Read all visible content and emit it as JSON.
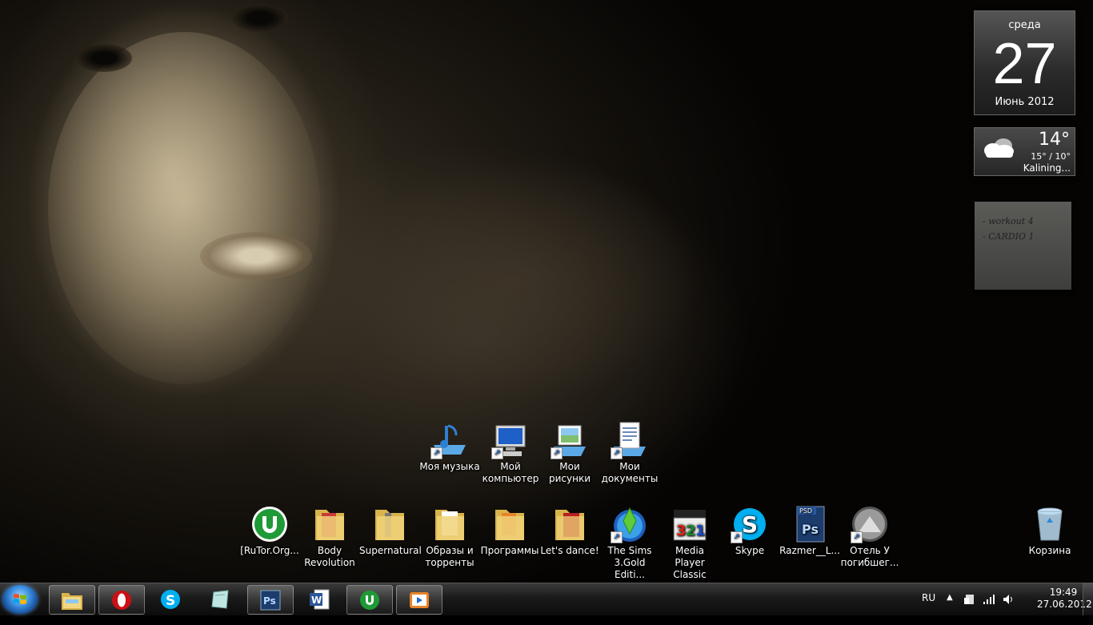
{
  "gadgets": {
    "calendar": {
      "weekday": "среда",
      "day": "27",
      "month_year": "Июнь 2012"
    },
    "weather": {
      "temperature": "14°",
      "range": "15° / 10°",
      "city": "Kalining..."
    },
    "note": {
      "lines": [
        "- workout 4",
        "- CARDIO 1"
      ]
    }
  },
  "desktop_icons_top": [
    {
      "label": "Моя музыка",
      "icon": "music-folder-icon"
    },
    {
      "label": "Мой компьютер",
      "icon": "computer-icon"
    },
    {
      "label": "Мои рисунки",
      "icon": "pictures-icon"
    },
    {
      "label": "Мои документы",
      "icon": "documents-icon"
    }
  ],
  "desktop_icons_bottom": [
    {
      "label": "[RuTor.Org...",
      "icon": "utorrent-icon"
    },
    {
      "label": "Body Revolution",
      "icon": "folder-icon"
    },
    {
      "label": "Supernatural",
      "icon": "folder-icon"
    },
    {
      "label": "Образы и торренты",
      "icon": "folder-icon"
    },
    {
      "label": "Программы",
      "icon": "folder-icon"
    },
    {
      "label": "Let's dance!",
      "icon": "folder-icon"
    },
    {
      "label": "The Sims 3.Gold Editi...",
      "icon": "sims-icon"
    },
    {
      "label": "Media Player Classic",
      "icon": "mpc-icon"
    },
    {
      "label": "Skype",
      "icon": "skype-icon"
    },
    {
      "label": "Razmer__L...",
      "icon": "psd-file-icon"
    },
    {
      "label": "Отель У погибшег...",
      "icon": "app-icon"
    }
  ],
  "recycle_bin": {
    "label": "Корзина"
  },
  "taskbar": {
    "items": [
      {
        "name": "explorer",
        "icon": "explorer-icon"
      },
      {
        "name": "opera",
        "icon": "opera-icon"
      },
      {
        "name": "skype",
        "icon": "skype-icon"
      },
      {
        "name": "sticky-notes",
        "icon": "notes-icon"
      },
      {
        "name": "photoshop",
        "icon": "photoshop-icon"
      },
      {
        "name": "word",
        "icon": "word-icon"
      },
      {
        "name": "utorrent",
        "icon": "utorrent-icon"
      },
      {
        "name": "media-player",
        "icon": "media-player-icon"
      }
    ],
    "language": "RU",
    "clock": {
      "time": "19:49",
      "date": "27.06.2012"
    }
  },
  "colors": {
    "utorrent": "#1e9a36",
    "skype": "#00aff0",
    "photoshop": "#1c3c6e",
    "opera": "#cc0f16",
    "word": "#2a5699"
  }
}
